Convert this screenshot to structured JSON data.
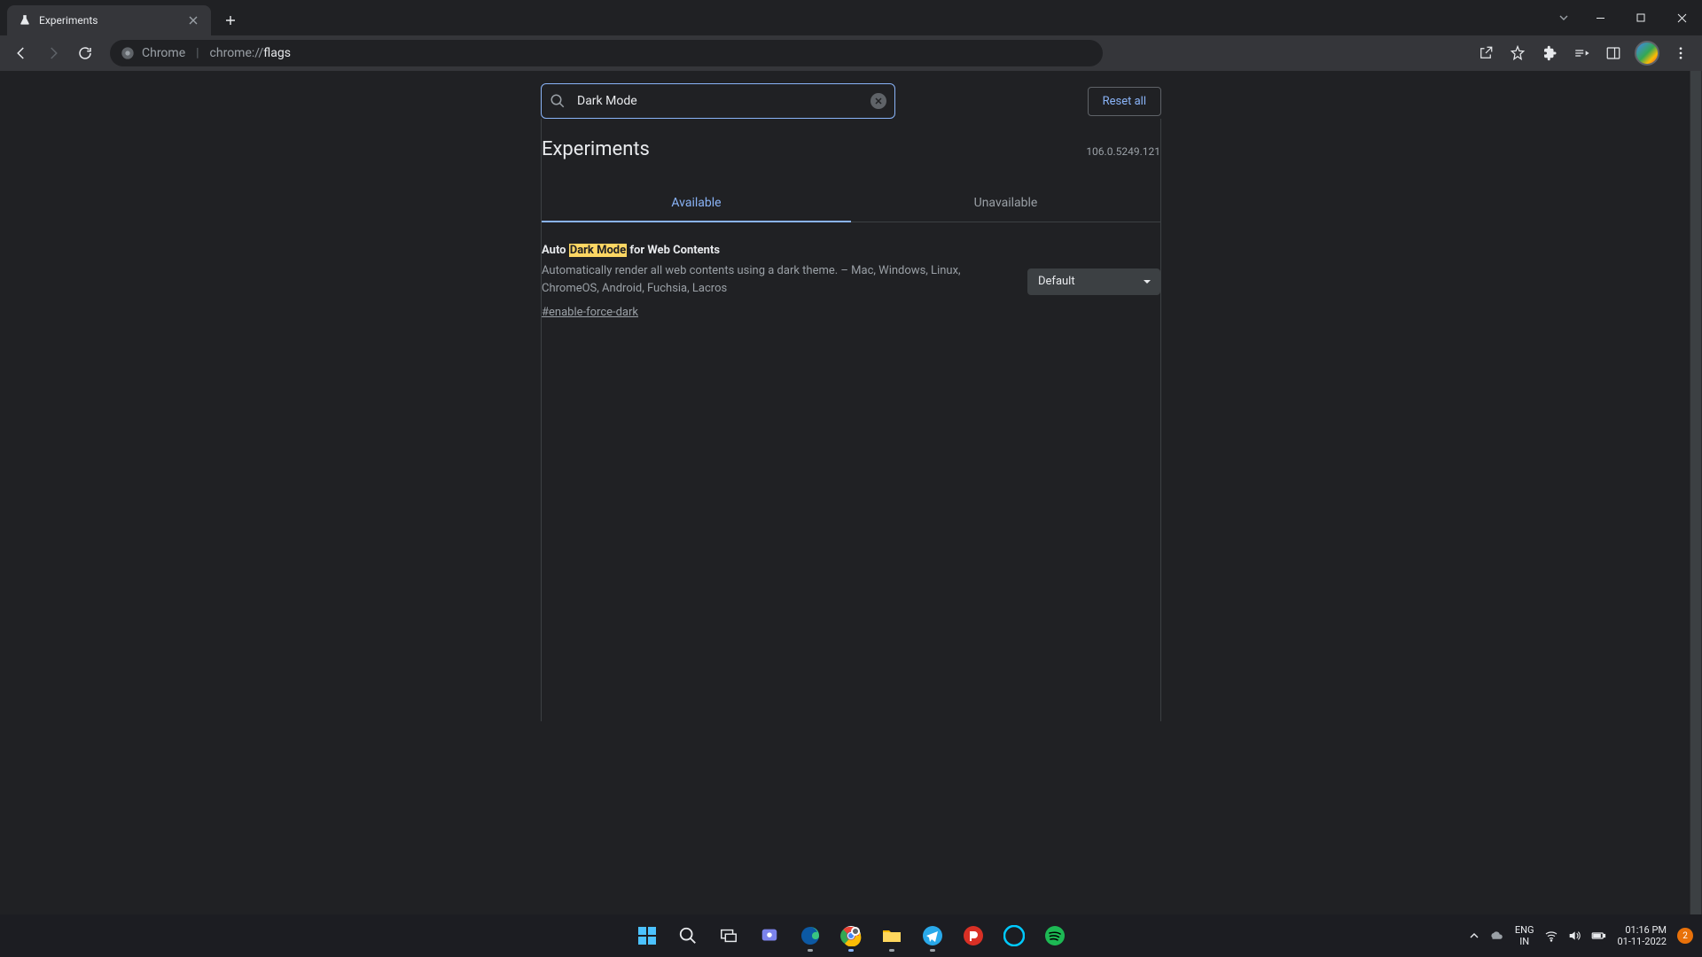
{
  "browser": {
    "tab_title": "Experiments",
    "url_product": "Chrome",
    "url_scheme": "chrome://",
    "url_path": "flags"
  },
  "header": {
    "search_value": "Dark Mode",
    "reset_label": "Reset all"
  },
  "page": {
    "title": "Experiments",
    "version": "106.0.5249.121",
    "tabs": {
      "available": "Available",
      "unavailable": "Unavailable"
    }
  },
  "flag": {
    "title_pre": "Auto ",
    "title_hl": "Dark Mode",
    "title_post": " for Web Contents",
    "description": "Automatically render all web contents using a dark theme. – Mac, Windows, Linux, ChromeOS, Android, Fuchsia, Lacros",
    "anchor": "#enable-force-dark",
    "select_value": "Default"
  },
  "system": {
    "lang_top": "ENG",
    "lang_bottom": "IN",
    "time": "01:16 PM",
    "date": "01-11-2022",
    "notif_count": "2"
  }
}
